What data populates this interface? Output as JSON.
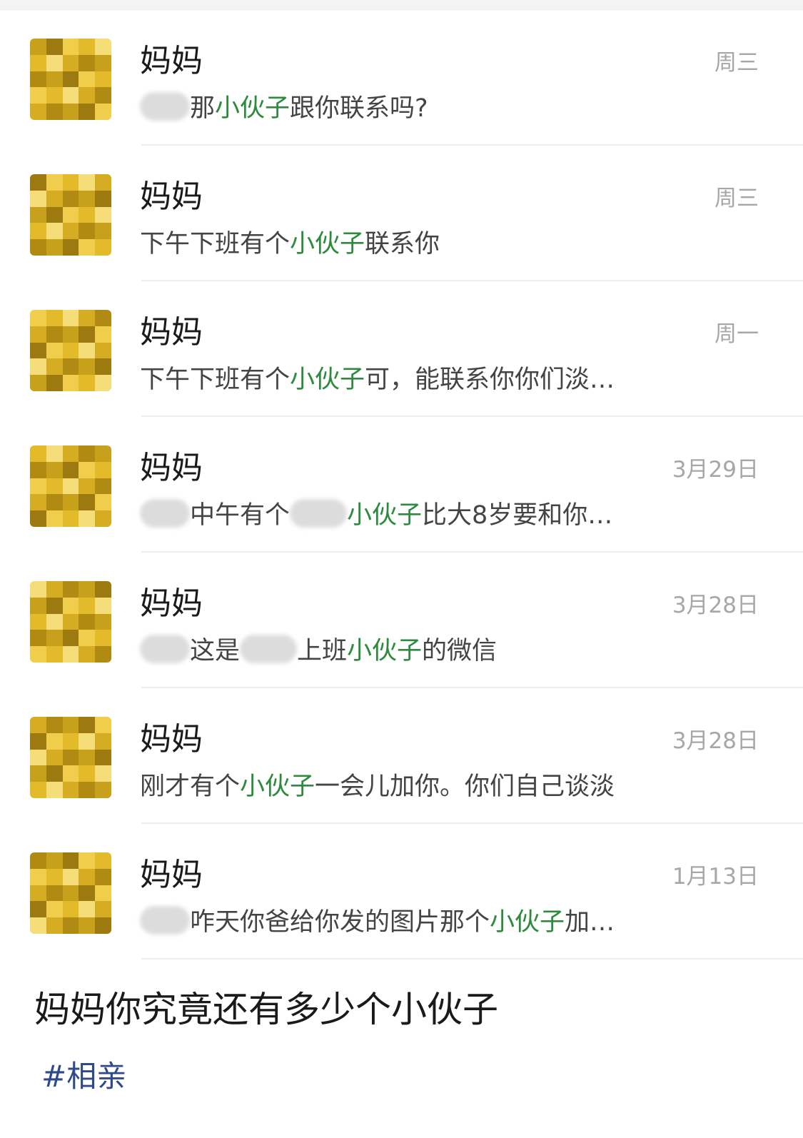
{
  "chat_list": {
    "items": [
      {
        "name": "妈妈",
        "time": "周三",
        "preview": [
          {
            "t": "blur",
            "w": 70
          },
          {
            "t": "text",
            "v": "那"
          },
          {
            "t": "hl",
            "v": "小伙子"
          },
          {
            "t": "text",
            "v": "跟你联系吗?"
          }
        ]
      },
      {
        "name": "妈妈",
        "time": "周三",
        "preview": [
          {
            "t": "text",
            "v": "下午下班有个"
          },
          {
            "t": "hl",
            "v": "小伙子"
          },
          {
            "t": "text",
            "v": "联系你"
          }
        ]
      },
      {
        "name": "妈妈",
        "time": "周一",
        "preview": [
          {
            "t": "text",
            "v": "下午下班有个"
          },
          {
            "t": "hl",
            "v": "小伙子"
          },
          {
            "t": "text",
            "v": "可，能联系你你们淡…"
          }
        ]
      },
      {
        "name": "妈妈",
        "time": "3月29日",
        "preview": [
          {
            "t": "blur",
            "w": 70
          },
          {
            "t": "text",
            "v": "中午有个"
          },
          {
            "t": "blur",
            "w": 80
          },
          {
            "t": "hl",
            "v": "小伙子"
          },
          {
            "t": "text",
            "v": "比大8岁要和你…"
          }
        ]
      },
      {
        "name": "妈妈",
        "time": "3月28日",
        "preview": [
          {
            "t": "blur",
            "w": 70
          },
          {
            "t": "text",
            "v": "这是"
          },
          {
            "t": "blur",
            "w": 80
          },
          {
            "t": "text",
            "v": "上班"
          },
          {
            "t": "hl",
            "v": "小伙子"
          },
          {
            "t": "text",
            "v": "的微信"
          }
        ]
      },
      {
        "name": "妈妈",
        "time": "3月28日",
        "preview": [
          {
            "t": "text",
            "v": "刚才有个"
          },
          {
            "t": "hl",
            "v": "小伙子"
          },
          {
            "t": "text",
            "v": "一会儿加你。你们自己谈淡"
          }
        ]
      },
      {
        "name": "妈妈",
        "time": "1月13日",
        "preview": [
          {
            "t": "blur",
            "w": 70
          },
          {
            "t": "text",
            "v": "咋天你爸给你发的图片那个"
          },
          {
            "t": "hl",
            "v": "小伙子"
          },
          {
            "t": "text",
            "v": "加…"
          }
        ]
      }
    ]
  },
  "post": {
    "caption": "妈妈你究竟还有多少个小伙子",
    "hashtag": "#相亲"
  },
  "colors": {
    "highlight": "#2e8b3e",
    "hashtag": "#2f4a8a",
    "timestamp": "#a7a7a7",
    "avatar_palette": [
      "#c8a11c",
      "#e3bb2a",
      "#b08a12",
      "#f0cd4a",
      "#d6ad22",
      "#9c7a10",
      "#f5dd7a"
    ]
  }
}
